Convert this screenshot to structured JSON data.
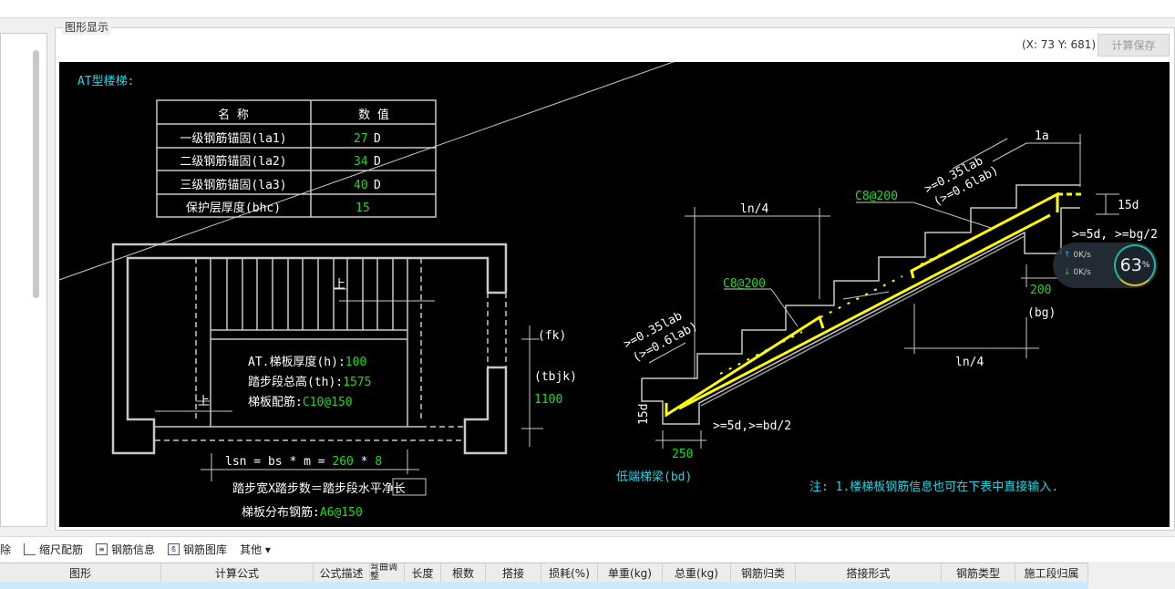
{
  "panel": {
    "title": "图形显示",
    "coords": "(X: 73 Y: 681)",
    "calc_save": "计算保存"
  },
  "drawing": {
    "title": "AT型楼梯:",
    "table": {
      "headers": [
        "名  称",
        "数  值"
      ],
      "rows": [
        {
          "name": "一级钢筋锚固(la1)",
          "value": "27",
          "unit": "D"
        },
        {
          "name": "二级钢筋锚固(la2)",
          "value": "34",
          "unit": "D"
        },
        {
          "name": "三级钢筋锚固(la3)",
          "value": "40",
          "unit": "D"
        },
        {
          "name": "保护层厚度(bhc)",
          "value": "15",
          "unit": ""
        }
      ]
    },
    "plan": {
      "up1": "上",
      "up2": "上",
      "thickness_label": "AT.梯板厚度(h):",
      "thickness": "100",
      "height_label": "踏步段总高(th):",
      "height": "1575",
      "rebar_label": "梯板配筋:",
      "rebar": "C10@150",
      "fk": "(fk)",
      "tbjk": "(tbjk)",
      "width": "1100",
      "lsn_label": "lsn = bs * m = ",
      "bs": "260",
      "times": " * ",
      "m": "8",
      "formula": "踏步宽X踏步数＝踏步段水平净长",
      "dist_label": "梯板分布钢筋:",
      "dist": "A6@150"
    },
    "section": {
      "ln4_left": "ln/4",
      "ln4_right": "ln/4",
      "la": "1a",
      "lab_top_1": ">=0.35lab",
      "lab_top_2": "(>=0.6lab)",
      "lab_bot_1": ">=0.35lab",
      "lab_bot_2": "(>=0.6lab)",
      "c8_top": "C8@200",
      "c8_bot": "C8@200",
      "d15_top": "15d",
      "d15_bot": "15d",
      "anchor_top": ">=5d, >=bg/2",
      "anchor_bot": ">=5d,>=bd/2",
      "bg_width": "200",
      "bg": "(bg)",
      "bd_width": "250",
      "bd_label": "低端梯梁(bd)",
      "note": "注: 1.楼梯板钢筋信息也可在下表中直接输入."
    },
    "colors": {
      "rebar": "#ffff00",
      "value": "#19e019",
      "cyan": "#1fd8e8",
      "line": "#c8c8c8"
    }
  },
  "net_widget": {
    "up": "0K/s",
    "down": "0K/s",
    "percent": "63",
    "percent_unit": "%"
  },
  "toolbar": {
    "delete_partial": "除",
    "scale": "缩尺配筋",
    "rebar_info": "钢筋信息",
    "rebar_lib": "钢筋图库",
    "other": "其他 ▾"
  },
  "table": {
    "columns": [
      "图形",
      "计算公式",
      "公式描述",
      "弯曲调整",
      "长度",
      "根数",
      "搭接",
      "损耗(%)",
      "单重(kg)",
      "总重(kg)",
      "钢筋归类",
      "搭接形式",
      "钢筋类型",
      "施工段归属"
    ]
  }
}
